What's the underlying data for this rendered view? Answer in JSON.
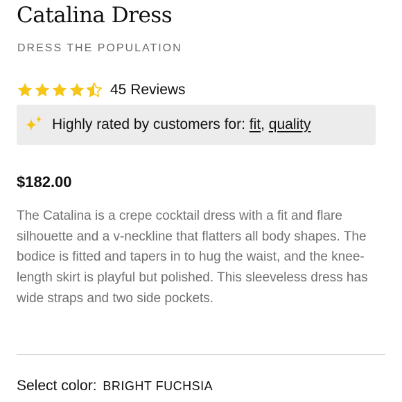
{
  "product": {
    "title": "Catalina Dress",
    "brand": "DRESS THE POPULATION",
    "rating": 4.5,
    "rating_max": 5,
    "reviews_label": "45 Reviews",
    "highlight": {
      "prefix": "Highly rated by customers for:",
      "tags": [
        "fit",
        "quality"
      ]
    },
    "price": "$182.00",
    "description": "The Catalina is a crepe cocktail dress with a fit and flare silhouette and a v-neckline that flatters all body shapes. The bodice is fitted and tapers in to hug the waist, and the knee-length skirt is playful but polished. This sleeveless dress has wide straps and two side pockets.",
    "color_label": "Select color:",
    "color_value": "BRIGHT FUCHSIA"
  },
  "icons": {
    "star": "star-icon",
    "half_star": "half-star-icon",
    "sparkle": "sparkle-icon"
  },
  "colors": {
    "star": "#f5c518",
    "sparkle": "#f5c518",
    "highlight_bg": "#ececec",
    "text": "#111111",
    "muted_text": "#707070"
  }
}
